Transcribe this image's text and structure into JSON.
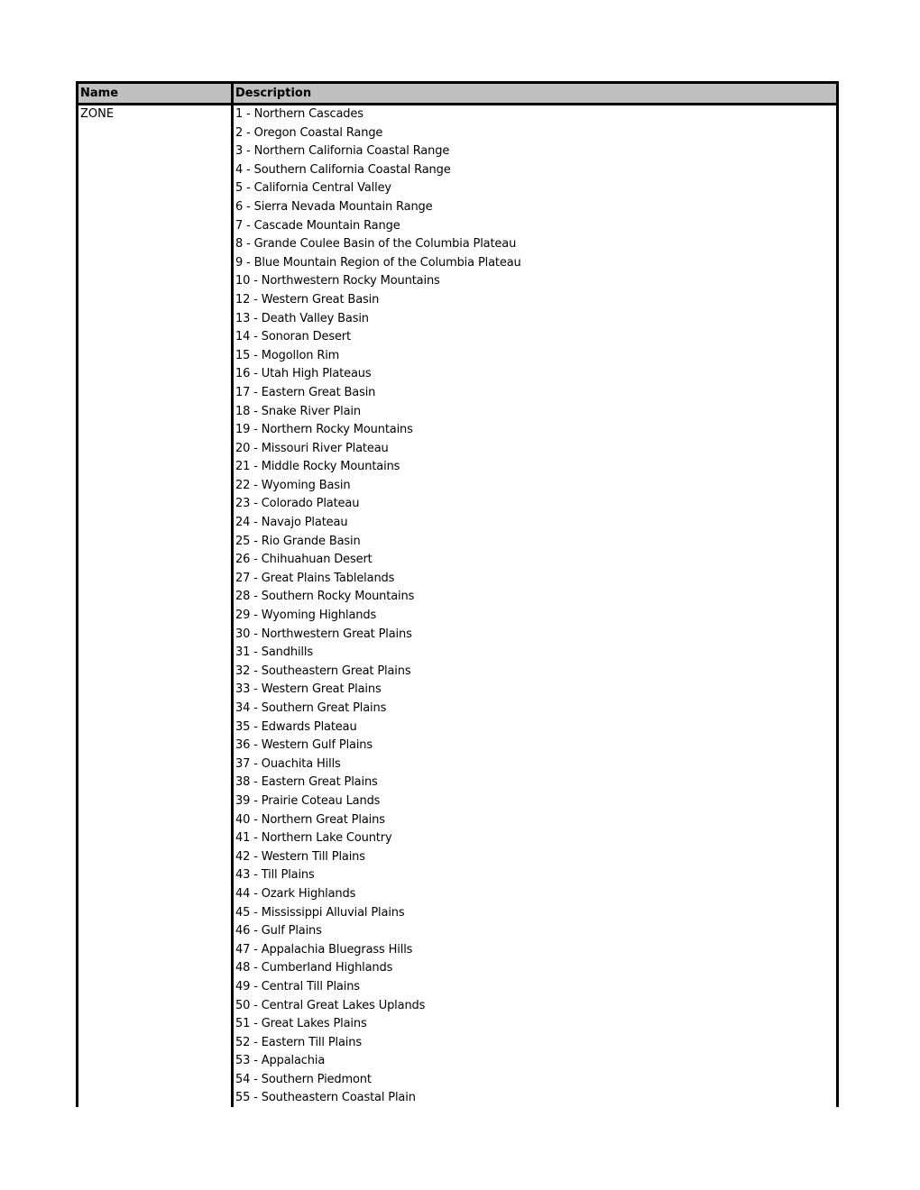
{
  "table": {
    "headers": {
      "name": "Name",
      "description": "Description"
    },
    "header_bg_color": "#c0c0c0",
    "rows": [
      {
        "name": "ZONE",
        "descriptions": [
          "1 - Northern Cascades",
          "2 - Oregon Coastal Range",
          "3 - Northern California Coastal Range",
          "4 - Southern California Coastal Range",
          "5 - California Central Valley",
          "6 - Sierra Nevada Mountain Range",
          "7 - Cascade Mountain Range",
          "8 - Grande Coulee Basin of the Columbia Plateau",
          "9 - Blue Mountain Region of the Columbia Plateau",
          "10 - Northwestern Rocky Mountains",
          "12 - Western Great Basin",
          "13 - Death Valley Basin",
          "14 - Sonoran Desert",
          "15 - Mogollon Rim",
          "16 - Utah High Plateaus",
          "17 - Eastern Great Basin",
          "18 - Snake River Plain",
          "19 - Northern Rocky Mountains",
          "20 - Missouri River Plateau",
          "21 - Middle Rocky Mountains",
          "22 - Wyoming Basin",
          "23 - Colorado Plateau",
          "24 - Navajo Plateau",
          "25 - Rio Grande Basin",
          "26 - Chihuahuan Desert",
          "27 - Great Plains Tablelands",
          "28 - Southern Rocky Mountains",
          "29 - Wyoming Highlands",
          "30 - Northwestern Great Plains",
          "31 - Sandhills",
          "32 - Southeastern Great Plains",
          "33 - Western Great Plains",
          "34 - Southern Great Plains",
          "35 - Edwards Plateau",
          "36 - Western Gulf Plains",
          "37 - Ouachita Hills",
          "38 - Eastern Great Plains",
          "39 - Prairie Coteau Lands",
          "40 - Northern Great Plains",
          "41 - Northern Lake Country",
          "42 - Western Till Plains",
          "43 - Till Plains",
          "44 - Ozark Highlands",
          "45 - Mississippi Alluvial Plains",
          "46 - Gulf Plains",
          "47 - Appalachia Bluegrass Hills",
          "48 - Cumberland Highlands",
          "49 - Central Till Plains",
          "50 - Central Great Lakes Uplands",
          "51 - Great Lakes Plains",
          "52 - Eastern Till Plains",
          "53 - Appalachia",
          "54 - Southern Piedmont",
          "55 - Southeastern Coastal Plain"
        ]
      }
    ]
  }
}
